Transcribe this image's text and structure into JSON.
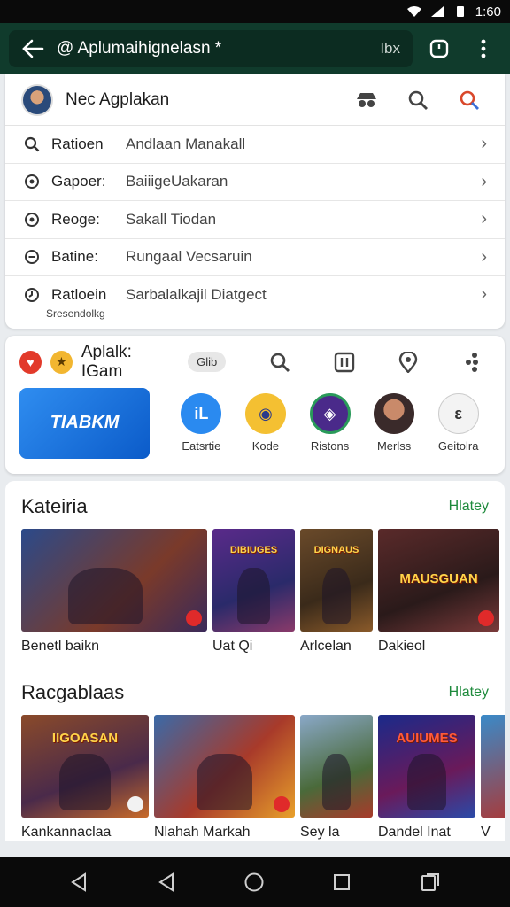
{
  "status": {
    "time": "1:60"
  },
  "appbar": {
    "url": "@ Aplumaihignelasn *",
    "tail": "Ibx"
  },
  "account": {
    "name": "Nec Agplakan"
  },
  "settings": [
    {
      "label": "Ratioen",
      "value": "Andlaan Manakall"
    },
    {
      "label": "Gapoer:",
      "value": "BaiiigeUakaran"
    },
    {
      "label": "Reoge:",
      "value": "Sakall Tiodan"
    },
    {
      "label": "Batine:",
      "value": "Rungaal Vecsaruin"
    },
    {
      "label": "Ratloein",
      "value": "Sarbalalkajil Diatgect"
    }
  ],
  "settings_note": "Sresendolkg",
  "games": {
    "title": "Aplalk: IGam",
    "pill": "Glib",
    "banner": "TIABKM",
    "shortcuts": [
      "Eatsrtie",
      "Kode",
      "Ristons",
      "Merlss",
      "Geitolra"
    ]
  },
  "section1": {
    "title": "Kateiria",
    "more": "Hlatey",
    "tiles": [
      {
        "label": "Benetl baikn",
        "art": ""
      },
      {
        "label": "Uat Qi",
        "art": "DIBIUGES"
      },
      {
        "label": "Arlcelan",
        "art": "DIGNAUS"
      },
      {
        "label": "Dakieol",
        "art": "MAUSGUAN"
      },
      {
        "label": "",
        "art": ""
      }
    ]
  },
  "section2": {
    "title": "Racgablaas",
    "more": "Hlatey",
    "tiles": [
      {
        "label": "Kankannaclaa",
        "art": "IIGOASAN"
      },
      {
        "label": "Nlahah Markah",
        "art": ""
      },
      {
        "label": "Sey la",
        "art": ""
      },
      {
        "label": "Dandel Inat",
        "art": "AUIUMES"
      },
      {
        "label": "V",
        "art": ""
      }
    ]
  },
  "colors": {
    "appbar": "#103b2c",
    "accent_green": "#1e8a3c",
    "banner_blue": "#1a74e0"
  }
}
